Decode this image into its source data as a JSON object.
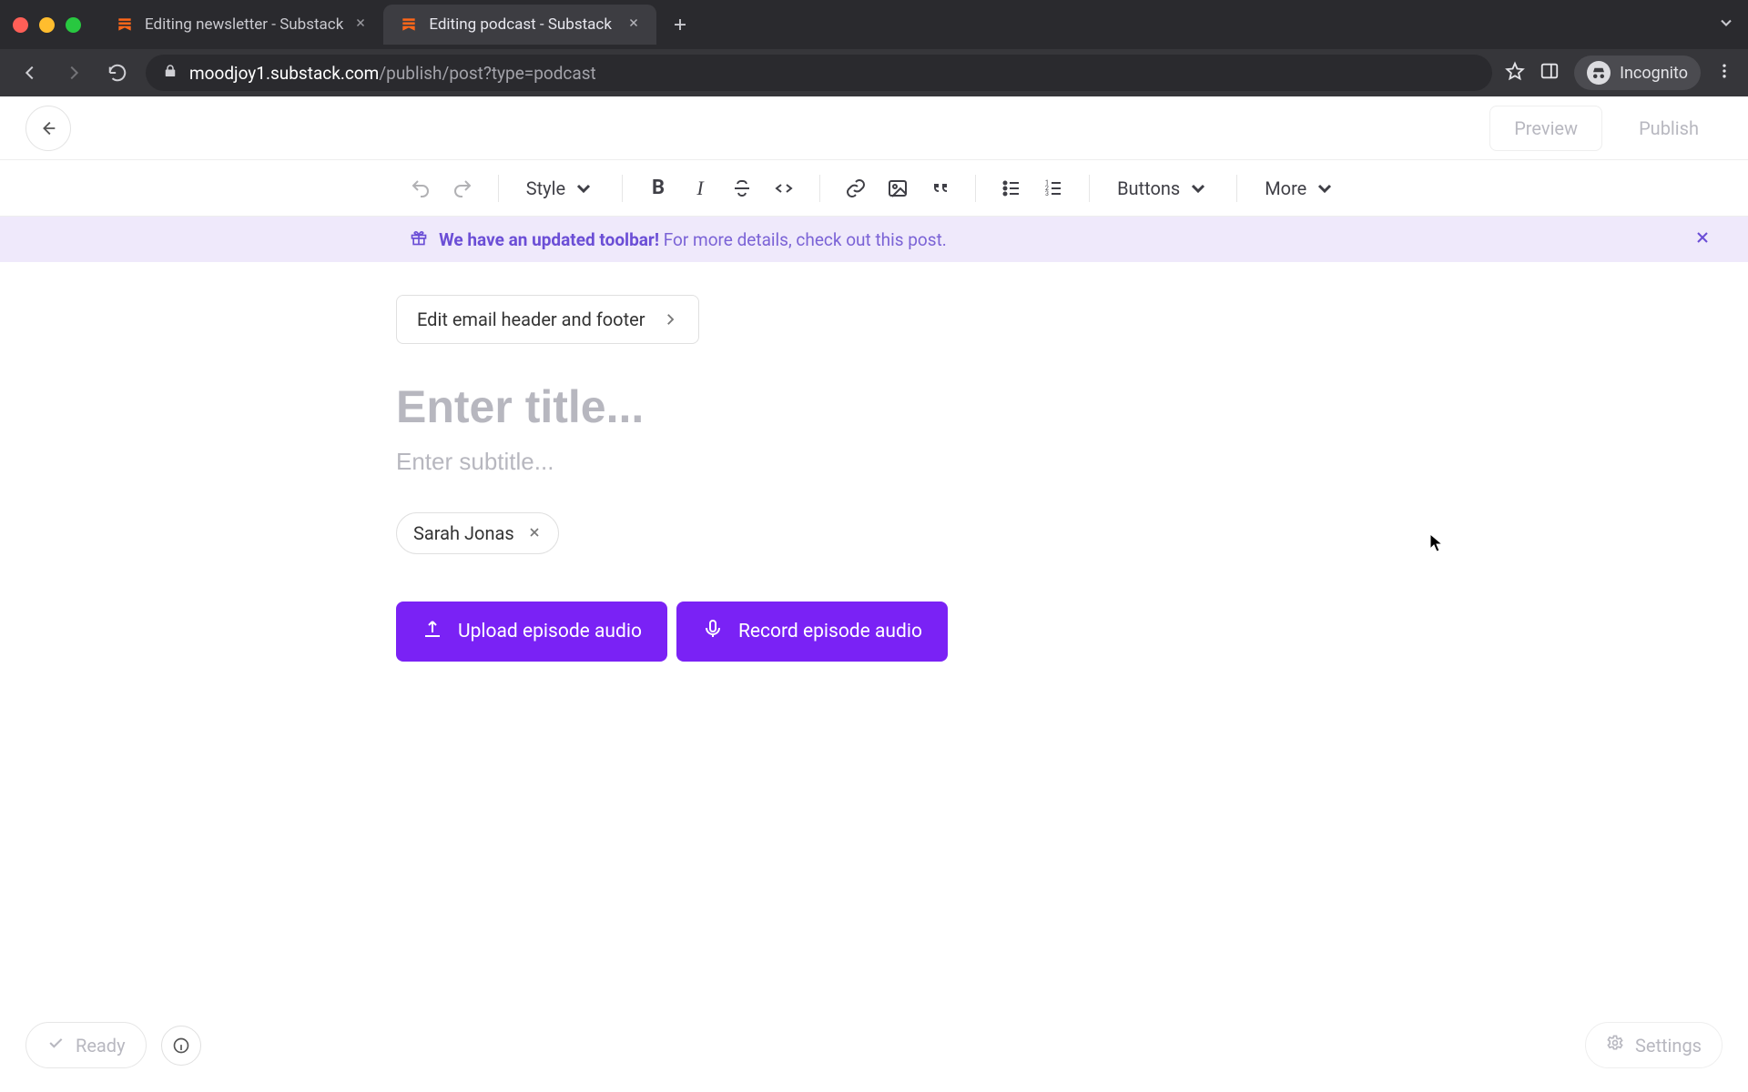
{
  "browser": {
    "tabs": [
      {
        "title": "Editing newsletter - Substack"
      },
      {
        "title": "Editing podcast - Substack"
      }
    ],
    "active_tab": 1,
    "url_host": "moodjoy1.substack.com",
    "url_path": "/publish/post?type=podcast",
    "incognito_label": "Incognito"
  },
  "header": {
    "preview_label": "Preview",
    "publish_label": "Publish"
  },
  "toolbar": {
    "style_label": "Style",
    "buttons_label": "Buttons",
    "more_label": "More"
  },
  "banner": {
    "strong": "We have an updated toolbar!",
    "rest": "For more details, check out this post."
  },
  "editor": {
    "email_header_footer_label": "Edit email header and footer",
    "title_placeholder": "Enter title...",
    "subtitle_placeholder": "Enter subtitle...",
    "author_name": "Sarah Jonas",
    "upload_label": "Upload episode audio",
    "record_label": "Record episode audio"
  },
  "footer": {
    "ready_label": "Ready",
    "settings_label": "Settings"
  }
}
